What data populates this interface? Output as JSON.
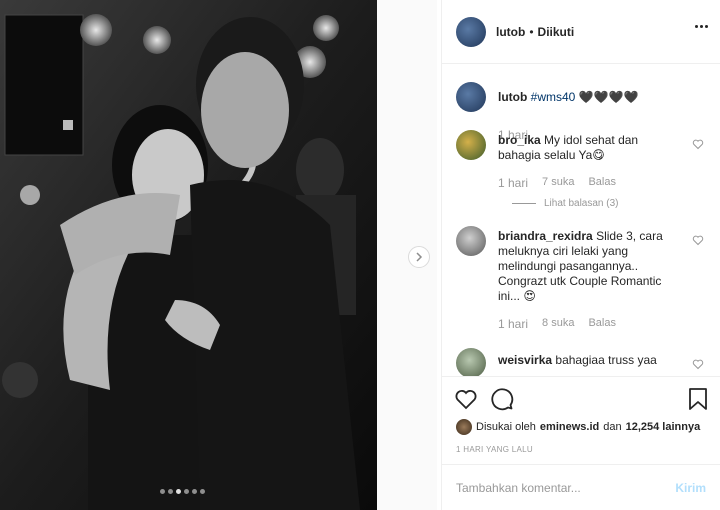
{
  "post": {
    "next_icon": "chevron-right-icon",
    "slides_count": 6,
    "active_slide": 3
  },
  "header": {
    "username": "lutob",
    "separator": "•",
    "follow_status": "Diikuti",
    "more_icon": "ellipsis-icon"
  },
  "caption": {
    "username": "lutob",
    "hashtag": "#wms40",
    "hearts": "🖤🖤🖤🖤",
    "time": "1 hari"
  },
  "comments": [
    {
      "username": "bro_ika",
      "text": "My idol sehat dan bahagia selalu Ya😋",
      "time": "1 hari",
      "likes": "7 suka",
      "reply": "Balas",
      "view_replies": "Lihat balasan (3)"
    },
    {
      "username": "briandra_rexidra",
      "text": "Slide 3, cara meluknya ciri lelaki yang melindungi pasangannya.. Congrazt utk Couple Romantic ini... 😍",
      "time": "1 hari",
      "likes": "8 suka",
      "reply": "Balas"
    },
    {
      "username": "weisvirka",
      "text": "bahagiaa truss yaa"
    }
  ],
  "actions": {
    "like_icon": "heart-icon",
    "comment_icon": "comment-icon",
    "bookmark_icon": "bookmark-icon",
    "liked_by_prefix": "Disukai oleh",
    "liked_by_user": "eminews.id",
    "liked_by_and": "dan",
    "liked_by_count": "12,254 lainnya",
    "timestamp": "1 HARI YANG LALU"
  },
  "add_comment": {
    "placeholder": "Tambahkan komentar...",
    "post_label": "Kirim"
  }
}
